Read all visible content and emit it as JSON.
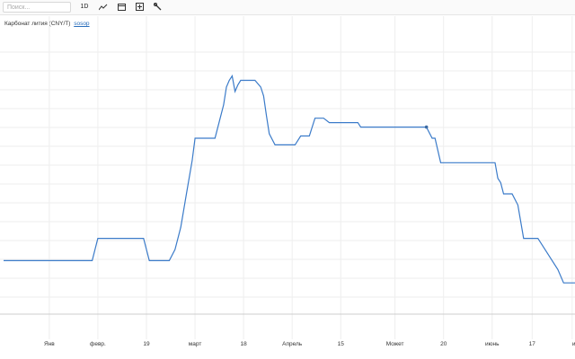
{
  "toolbar": {
    "search_placeholder": "Поиск...",
    "interval_label": "1D",
    "icons": [
      "line-chart-icon",
      "calendar-icon",
      "add-indicator-icon",
      "tools-icon"
    ]
  },
  "chart_title": {
    "name": "Карбонат лития (CNY/T)",
    "source": "sosop"
  },
  "colors": {
    "line": "#3b7bc9",
    "grid": "#eeeeee",
    "axis": "#cccccc",
    "marker": "#3b6aa3"
  },
  "chart_data": {
    "type": "line",
    "title": "Карбонат лития (CNY/T)",
    "xlabel": "",
    "ylabel": "",
    "grid": true,
    "x_ticks": [
      {
        "label": "Янв",
        "t": 0.08
      },
      {
        "label": "февр.",
        "t": 0.165
      },
      {
        "label": "19",
        "t": 0.25
      },
      {
        "label": "март",
        "t": 0.335
      },
      {
        "label": "18",
        "t": 0.42
      },
      {
        "label": "Апрель",
        "t": 0.505
      },
      {
        "label": "15",
        "t": 0.59
      },
      {
        "label": "Может",
        "t": 0.685
      },
      {
        "label": "20",
        "t": 0.77
      },
      {
        "label": "июнь",
        "t": 0.855
      },
      {
        "label": "17",
        "t": 0.925
      },
      {
        "label": "ию",
        "t": 0.995
      }
    ],
    "ylim": [
      0,
      100
    ],
    "series": [
      {
        "marker_index": 35,
        "points": [
          [
            0.0,
            20
          ],
          [
            0.155,
            20
          ],
          [
            0.165,
            30
          ],
          [
            0.245,
            30
          ],
          [
            0.255,
            20
          ],
          [
            0.29,
            20
          ],
          [
            0.3,
            25
          ],
          [
            0.31,
            35
          ],
          [
            0.32,
            50
          ],
          [
            0.33,
            65
          ],
          [
            0.335,
            75
          ],
          [
            0.37,
            75
          ],
          [
            0.38,
            85
          ],
          [
            0.385,
            90
          ],
          [
            0.39,
            98
          ],
          [
            0.395,
            101
          ],
          [
            0.4,
            103
          ],
          [
            0.405,
            96
          ],
          [
            0.41,
            99
          ],
          [
            0.415,
            101
          ],
          [
            0.44,
            101
          ],
          [
            0.45,
            98
          ],
          [
            0.455,
            94
          ],
          [
            0.46,
            85
          ],
          [
            0.465,
            77
          ],
          [
            0.475,
            72
          ],
          [
            0.5,
            72
          ],
          [
            0.51,
            72
          ],
          [
            0.52,
            76
          ],
          [
            0.535,
            76
          ],
          [
            0.545,
            84
          ],
          [
            0.56,
            84
          ],
          [
            0.57,
            82
          ],
          [
            0.62,
            82
          ],
          [
            0.625,
            80
          ],
          [
            0.74,
            80
          ],
          [
            0.75,
            75
          ],
          [
            0.755,
            75
          ],
          [
            0.765,
            64
          ],
          [
            0.86,
            64
          ],
          [
            0.865,
            57
          ],
          [
            0.87,
            55
          ],
          [
            0.875,
            50
          ],
          [
            0.89,
            50
          ],
          [
            0.9,
            45
          ],
          [
            0.91,
            30
          ],
          [
            0.935,
            30
          ],
          [
            0.97,
            16
          ],
          [
            0.98,
            10
          ],
          [
            1.0,
            10
          ]
        ]
      }
    ]
  }
}
